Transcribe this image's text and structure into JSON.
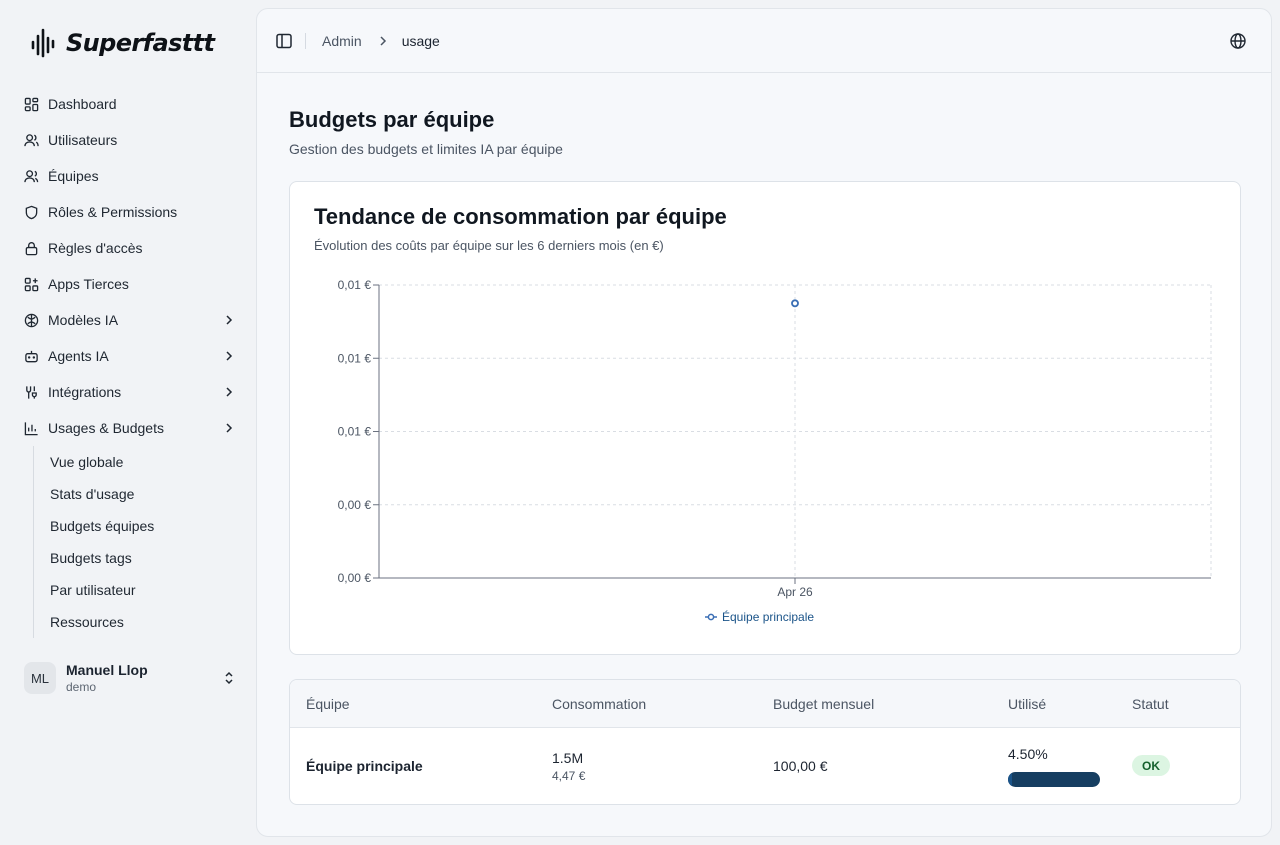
{
  "brand": {
    "name": "Superfasttt"
  },
  "sidebar": {
    "items": [
      {
        "label": "Dashboard",
        "icon": "dashboard-icon"
      },
      {
        "label": "Utilisateurs",
        "icon": "users-icon"
      },
      {
        "label": "Équipes",
        "icon": "team-icon"
      },
      {
        "label": "Rôles & Permissions",
        "icon": "shield-icon"
      },
      {
        "label": "Règles d'accès",
        "icon": "lock-icon"
      },
      {
        "label": "Apps Tierces",
        "icon": "apps-icon"
      },
      {
        "label": "Modèles IA",
        "icon": "brain-icon"
      },
      {
        "label": "Agents IA",
        "icon": "bot-icon"
      },
      {
        "label": "Intégrations",
        "icon": "integration-icon"
      },
      {
        "label": "Usages & Budgets",
        "icon": "bar-chart-icon"
      }
    ],
    "subitems": [
      "Vue globale",
      "Stats d'usage",
      "Budgets équipes",
      "Budgets tags",
      "Par utilisateur",
      "Ressources"
    ]
  },
  "user": {
    "initials": "ML",
    "name": "Manuel Llop",
    "role": "demo"
  },
  "breadcrumb": {
    "parent": "Admin",
    "current": "usage"
  },
  "page": {
    "title": "Budgets par équipe",
    "subtitle": "Gestion des budgets et limites IA par équipe"
  },
  "chart": {
    "title": "Tendance de consommation par équipe",
    "subtitle": "Évolution des coûts par équipe sur les 6 derniers mois (en €)"
  },
  "chart_data": {
    "type": "line",
    "title": "Tendance de consommation par équipe",
    "subtitle": "Évolution des coûts par équipe sur les 6 derniers mois (en €)",
    "categories": [
      "Apr 26"
    ],
    "y_tick_labels": [
      "0,00 €",
      "0,00 €",
      "0,01 €",
      "0,01 €",
      "0,01 €"
    ],
    "ylim": [
      0,
      0.008
    ],
    "grid": true,
    "legend_position": "bottom-center",
    "series": [
      {
        "name": "Équipe principale",
        "values": [
          0.0075
        ],
        "color": "#3b6fb5"
      }
    ]
  },
  "table": {
    "headers": [
      "Équipe",
      "Consommation",
      "Budget mensuel",
      "Utilisé",
      "Statut"
    ],
    "rows": [
      {
        "team": "Équipe principale",
        "consumption": "1.5M",
        "consumption_cost": "4,47 €",
        "budget": "100,00 €",
        "used": "4.50%",
        "used_value": 0.045,
        "status": "OK"
      }
    ]
  },
  "colors": {
    "accent": "#163e61",
    "success_bg": "#dcf5e2",
    "success_text": "#16612e",
    "series": "#3b6fb5"
  }
}
